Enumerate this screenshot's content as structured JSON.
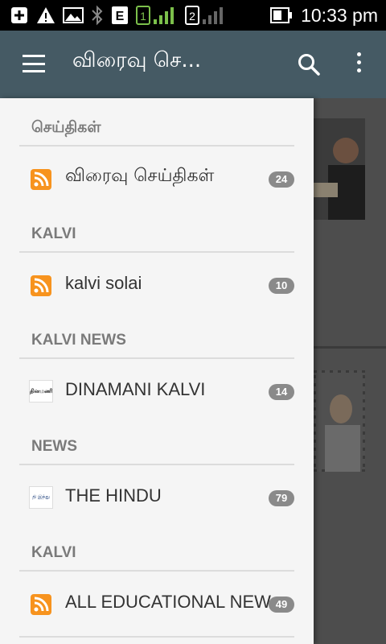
{
  "status_bar": {
    "time": "10:33 pm",
    "sim1": "1",
    "sim2": "2",
    "network": "E",
    "icons": [
      "add-icon",
      "warning-icon",
      "image-icon",
      "bluetooth-icon",
      "network-e-icon",
      "sim1-signal-icon",
      "sim2-signal-icon",
      "battery-icon"
    ]
  },
  "app_bar": {
    "title": "விரைவு செ...",
    "color": "#455a64"
  },
  "drawer": {
    "sections": [
      {
        "header": "செய்திகள்",
        "items": [
          {
            "label": "விரைவு செய்திகள்",
            "count": "24",
            "icon": "rss-icon"
          }
        ]
      },
      {
        "header": "KALVI",
        "items": [
          {
            "label": "kalvi solai",
            "count": "10",
            "icon": "rss-icon"
          }
        ]
      },
      {
        "header": "KALVI NEWS",
        "items": [
          {
            "label": "DINAMANI KALVI",
            "count": "14",
            "icon": "dinamani-icon"
          }
        ]
      },
      {
        "header": "NEWS",
        "items": [
          {
            "label": "THE HINDU",
            "count": "79",
            "icon": "the-hindu-icon"
          }
        ]
      },
      {
        "header": "KALVI",
        "items": [
          {
            "label": "ALL EDUCATIONAL NEW",
            "count": "49",
            "icon": "rss-icon"
          }
        ]
      }
    ],
    "logo_text": {
      "dinamani": "தினமணி",
      "hindu": "தி இந்து"
    }
  },
  "colors": {
    "rss": "#f7931e",
    "badge": "#8a8a8a",
    "drawer_bg": "#f5f5f5",
    "header_text": "#7a7a7a"
  }
}
